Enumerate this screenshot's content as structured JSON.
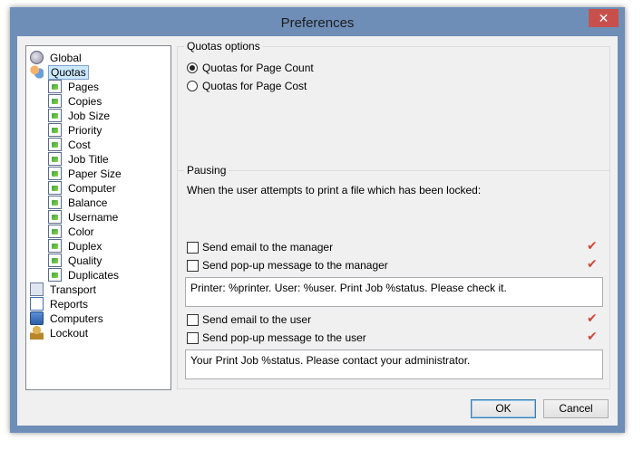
{
  "window": {
    "title": "Preferences",
    "close_glyph": "✕"
  },
  "tree": {
    "items": [
      {
        "label": "Global",
        "icon": "globe-icon"
      },
      {
        "label": "Quotas",
        "icon": "users-icon",
        "selected": true
      },
      {
        "label": "Pages",
        "icon": "quota-icon"
      },
      {
        "label": "Copies",
        "icon": "quota-icon"
      },
      {
        "label": "Job Size",
        "icon": "quota-icon"
      },
      {
        "label": "Priority",
        "icon": "quota-icon"
      },
      {
        "label": "Cost",
        "icon": "quota-icon"
      },
      {
        "label": "Job Title",
        "icon": "quota-icon"
      },
      {
        "label": "Paper Size",
        "icon": "quota-icon"
      },
      {
        "label": "Computer",
        "icon": "quota-icon"
      },
      {
        "label": "Balance",
        "icon": "quota-icon"
      },
      {
        "label": "Username",
        "icon": "quota-icon"
      },
      {
        "label": "Color",
        "icon": "quota-icon"
      },
      {
        "label": "Duplex",
        "icon": "quota-icon"
      },
      {
        "label": "Quality",
        "icon": "quota-icon"
      },
      {
        "label": "Duplicates",
        "icon": "quota-icon"
      },
      {
        "label": "Transport",
        "icon": "transport-icon"
      },
      {
        "label": "Reports",
        "icon": "reports-icon"
      },
      {
        "label": "Computers",
        "icon": "computers-icon"
      },
      {
        "label": "Lockout",
        "icon": "lockout-icon"
      }
    ]
  },
  "quotas": {
    "title": "Quotas options",
    "options": [
      {
        "label": "Quotas for Page Count",
        "selected": true
      },
      {
        "label": "Quotas for Page Cost",
        "selected": false
      }
    ]
  },
  "pausing": {
    "title": "Pausing",
    "description": "When the user attempts to print a file which has been locked:",
    "email_manager": "Send email to the manager",
    "popup_manager": "Send pop-up message to the manager",
    "manager_message": "Printer: %printer. User: %user. Print Job %status. Please check it.",
    "email_user": "Send email to the user",
    "popup_user": "Send pop-up message to the user",
    "user_message": "Your Print Job %status. Please contact your administrator.",
    "tick_glyph": "✔",
    "tick_color": "#d2483a"
  },
  "buttons": {
    "ok": "OK",
    "cancel": "Cancel"
  }
}
